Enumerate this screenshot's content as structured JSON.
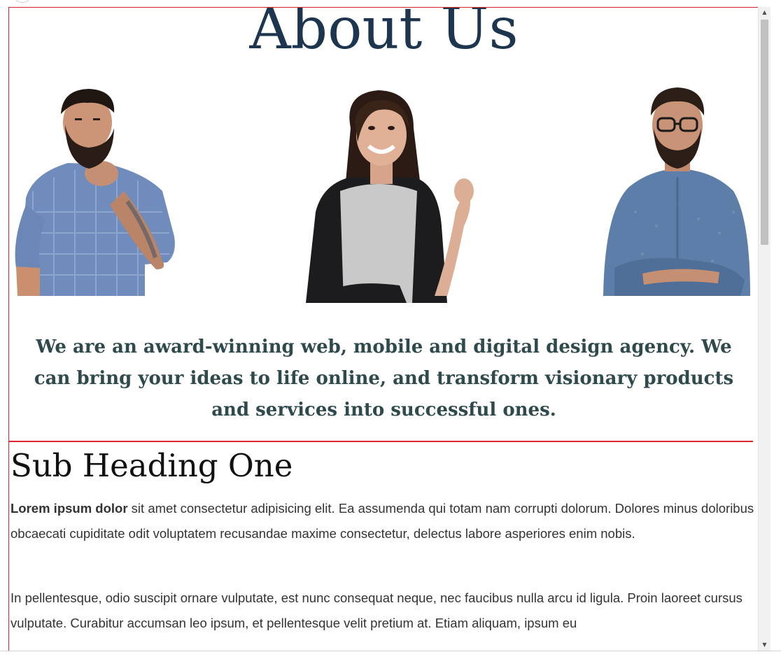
{
  "page": {
    "title": "About Us",
    "intro": "We are an award-winning web, mobile and digital design agency. We can bring your ideas to life online, and transform visionary products and services into successful ones.",
    "section": {
      "heading": "Sub Heading One",
      "paragraph_1_bold": "Lorem ipsum dolor",
      "paragraph_1_rest": " sit amet consectetur adipisicing elit. Ea assumenda qui totam nam corrupti dolorum. Dolores minus doloribus obcaecati cupiditate odit voluptatem recusandae maxime consectetur, delectus labore asperiores enim nobis.",
      "paragraph_2": "In pellentesque, odio suscipit ornare vulputate, est nunc consequat neque, nec faucibus nulla arcu id ligula. Proin laoreet cursus vulputate. Curabitur accumsan leo ipsum, et pellentesque velit pretium at. Etiam aliquam, ipsum eu"
    },
    "team": [
      {
        "photo": "bearded-man-thinking-photo"
      },
      {
        "photo": "smiling-woman-photo"
      },
      {
        "photo": "man-with-glasses-arms-crossed-photo"
      }
    ]
  },
  "colors": {
    "title": "#1e3550",
    "intro": "#2f4a4d",
    "accent_border": "#d9272e",
    "body_text": "#333333"
  },
  "icons": {
    "scroll_up": "scroll-up-arrow-icon",
    "scroll_down": "scroll-down-arrow-icon"
  }
}
